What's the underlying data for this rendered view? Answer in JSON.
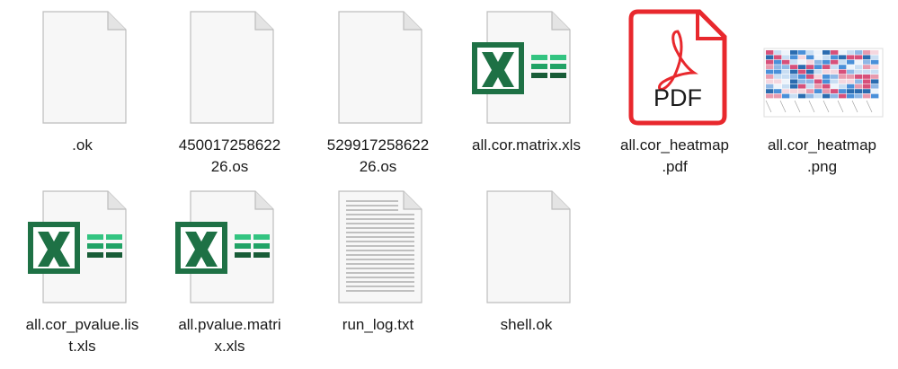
{
  "files": [
    {
      "name": ".ok",
      "type": "blank"
    },
    {
      "name": "450017258622\n26.os",
      "type": "blank"
    },
    {
      "name": "529917258622\n26.os",
      "type": "blank"
    },
    {
      "name": "all.cor.matrix.xls",
      "type": "excel"
    },
    {
      "name": "all.cor_heatmap\n.pdf",
      "type": "pdf",
      "badge": "PDF"
    },
    {
      "name": "all.cor_heatmap\n.png",
      "type": "image"
    },
    {
      "name": "all.cor_pvalue.lis\nt.xls",
      "type": "excel"
    },
    {
      "name": "all.pvalue.matri\nx.xls",
      "type": "excel"
    },
    {
      "name": "run_log.txt",
      "type": "text"
    },
    {
      "name": "shell.ok",
      "type": "blank"
    }
  ],
  "colors": {
    "excel_green": "#1e7145",
    "pdf_red": "#e8282d",
    "page_fill": "#f7f7f7",
    "page_border": "#b8b8b8"
  }
}
